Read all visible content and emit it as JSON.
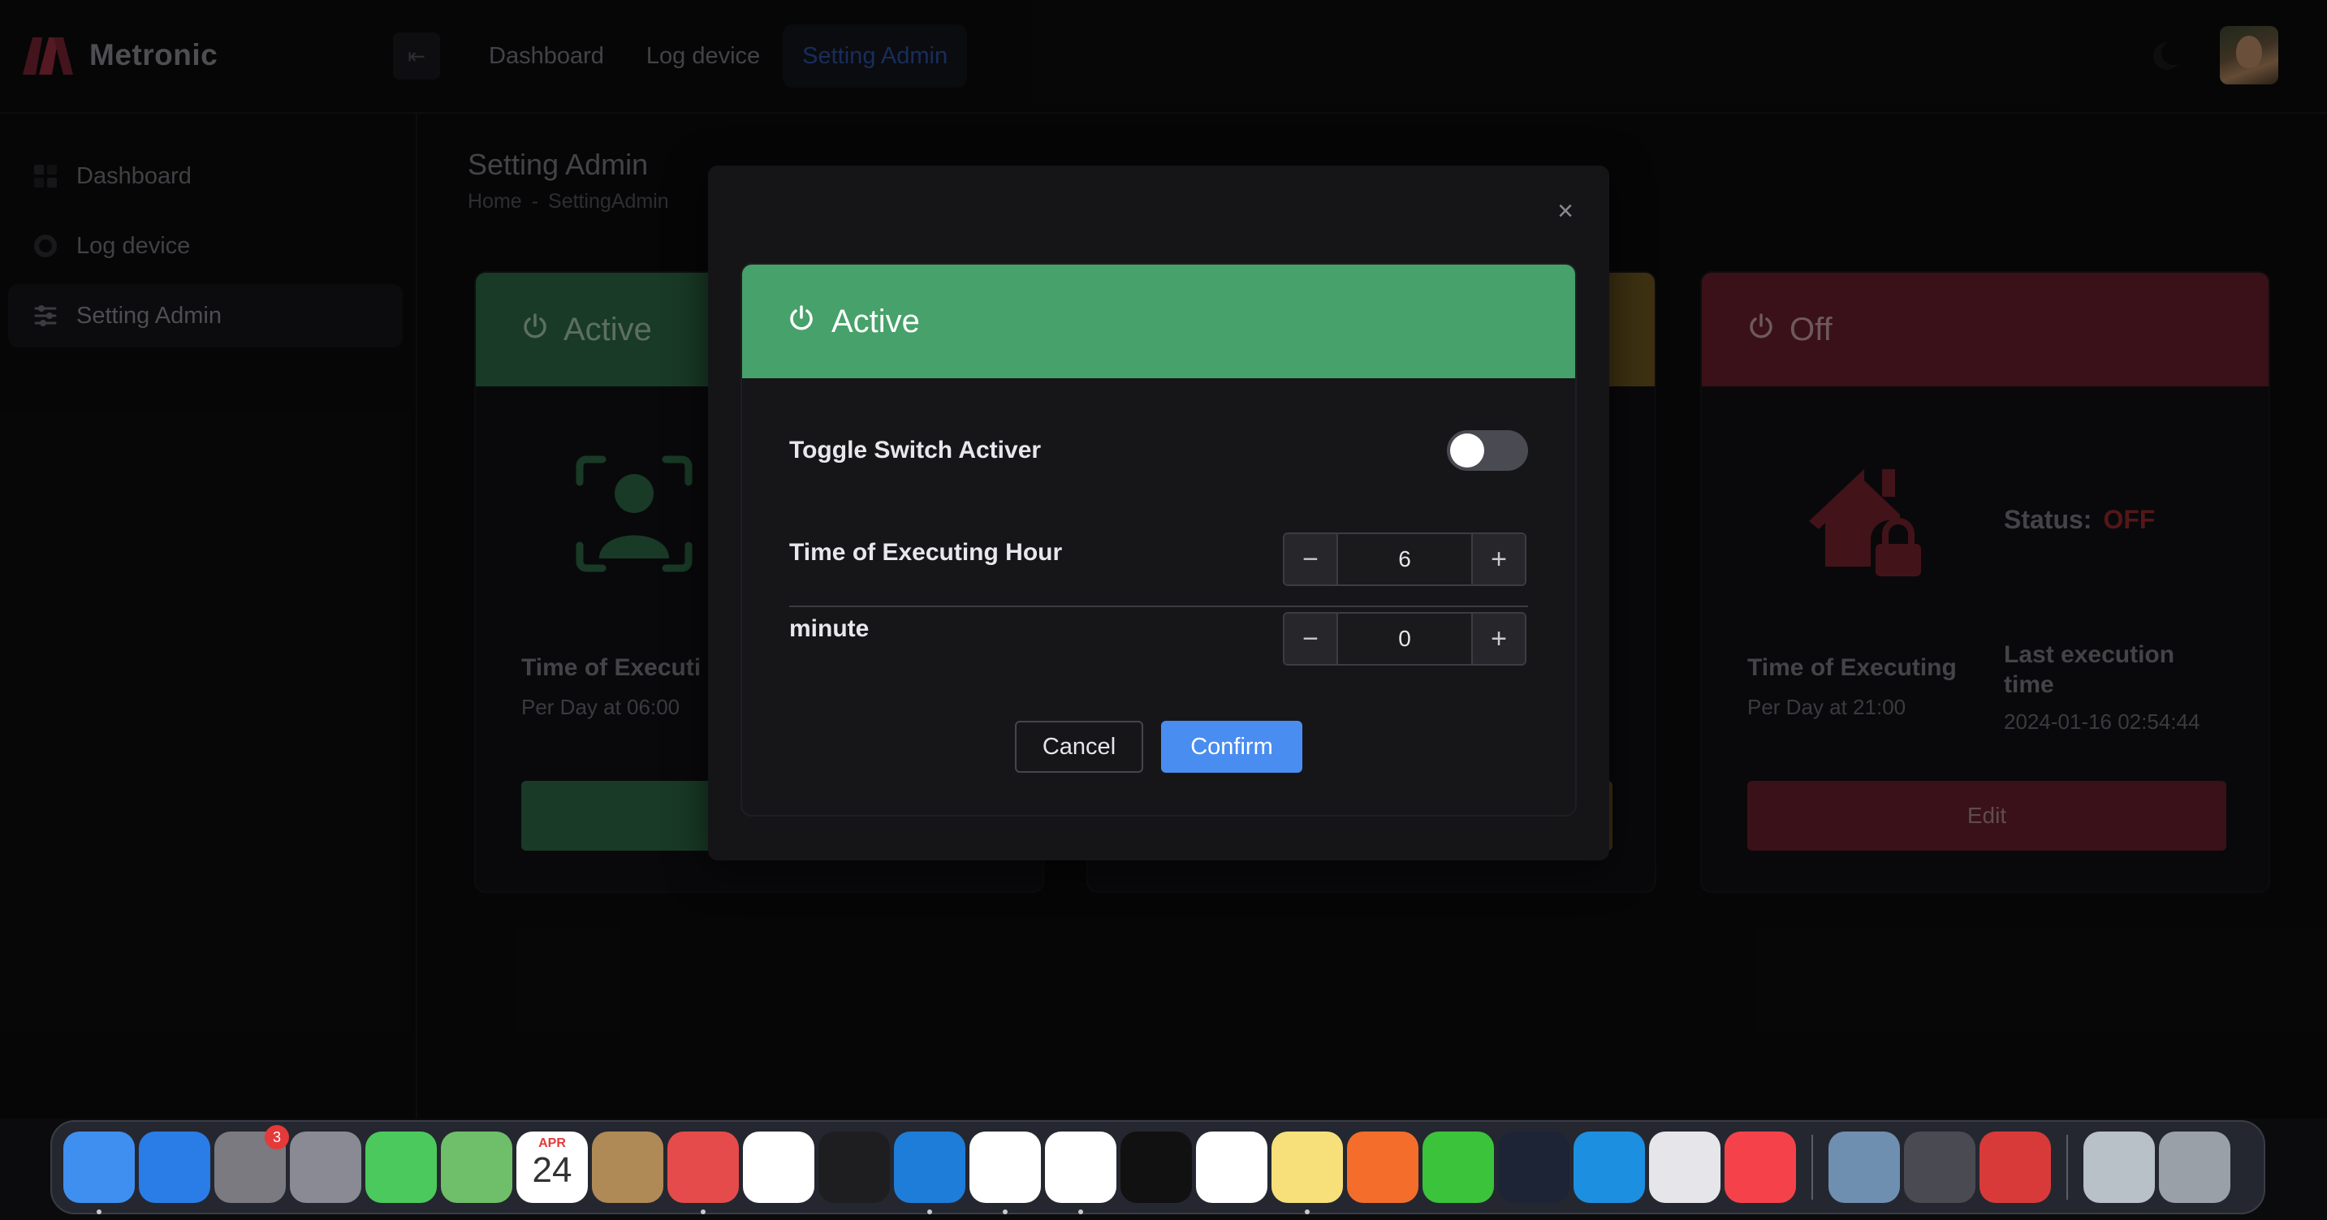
{
  "app": {
    "brand": "Metronic"
  },
  "top_nav": [
    {
      "label": "Dashboard",
      "active": false
    },
    {
      "label": "Log device",
      "active": false
    },
    {
      "label": "Setting Admin",
      "active": true
    }
  ],
  "sidebar": {
    "items": [
      {
        "label": "Dashboard",
        "icon": "grid-icon"
      },
      {
        "label": "Log device",
        "icon": "circle-icon"
      },
      {
        "label": "Setting Admin",
        "icon": "sliders-icon",
        "active": true
      }
    ]
  },
  "page": {
    "title": "Setting Admin",
    "breadcrumb": [
      "Home",
      "-",
      "SettingAdmin"
    ]
  },
  "cards": [
    {
      "status_title": "Active",
      "color": "#2f6b45",
      "icon": "face-scan-icon",
      "time_label": "Time of Executi",
      "time_value": "Per Day at 06:00",
      "button_color": "#2f6b45"
    },
    {
      "status_title": "",
      "color": "#6f5a1f",
      "icon": "",
      "button_color": "#6f5a1f"
    },
    {
      "status_title": "Off",
      "color": "#6a1f2c",
      "icon": "house-lock-icon",
      "status_label": "Status:",
      "status_value": "OFF",
      "time_label": "Time of Executing",
      "time_value": "Per Day at 21:00",
      "last_label": "Last execution time",
      "last_value": "2024-01-16 02:54:44",
      "button_label": "Edit",
      "button_color": "#6a1f2c"
    }
  ],
  "modal": {
    "header_title": "Active",
    "header_color": "#47a16a",
    "toggle_label": "Toggle Switch Activer",
    "toggle_on": false,
    "hour_label": "Time of Executing Hour",
    "hour_value": "6",
    "minute_label": "minute",
    "minute_value": "0",
    "cancel_label": "Cancel",
    "confirm_label": "Confirm",
    "confirm_color": "#4a8df0"
  },
  "dock": {
    "apps": [
      {
        "name": "finder-icon",
        "color": "#3f8ff0",
        "running": true
      },
      {
        "name": "app-store-icon",
        "color": "#2a7de6"
      },
      {
        "name": "system-settings-icon",
        "color": "#7a7a80",
        "badge": "3"
      },
      {
        "name": "launchpad-icon",
        "color": "#8a8a94"
      },
      {
        "name": "messages-icon",
        "color": "#4bc95d"
      },
      {
        "name": "maps-icon",
        "color": "#6fbf6a"
      },
      {
        "name": "calendar-icon",
        "color": "#ffffff",
        "month": "APR",
        "day": "24"
      },
      {
        "name": "contacts-icon",
        "color": "#b08a56"
      },
      {
        "name": "mail-icon",
        "color": "#e64b4b",
        "running": true
      },
      {
        "name": "mongodb-compass-icon",
        "color": "#ffffff"
      },
      {
        "name": "terminal-icon",
        "color": "#1e1e20"
      },
      {
        "name": "edge-icon",
        "color": "#1d7dd8",
        "running": true
      },
      {
        "name": "chrome-icon",
        "color": "#ffffff",
        "running": true
      },
      {
        "name": "vscode-icon",
        "color": "#ffffff",
        "running": true
      },
      {
        "name": "intellij-icon",
        "color": "#111111"
      },
      {
        "name": "xcode-instruments-icon",
        "color": "#ffffff"
      },
      {
        "name": "notes-icon",
        "color": "#f7e07a",
        "running": true
      },
      {
        "name": "postman-icon",
        "color": "#f46d2b"
      },
      {
        "name": "line-icon",
        "color": "#3bc33b"
      },
      {
        "name": "powershell-icon",
        "color": "#1c2436"
      },
      {
        "name": "docker-icon",
        "color": "#1d8fe0"
      },
      {
        "name": "pgadmin-icon",
        "color": "#e6e6ea"
      },
      {
        "name": "music-icon",
        "color": "#f5424a"
      },
      {
        "name": "preview-icon",
        "color": "#6f8fb0"
      },
      {
        "name": "quicktime-icon",
        "color": "#4a4a52"
      },
      {
        "name": "photo-booth-icon",
        "color": "#d83a3a"
      },
      {
        "name": "downloads-stack-icon",
        "color": "#b8c0c8"
      },
      {
        "name": "trash-icon",
        "color": "#9aa0a8"
      }
    ]
  }
}
